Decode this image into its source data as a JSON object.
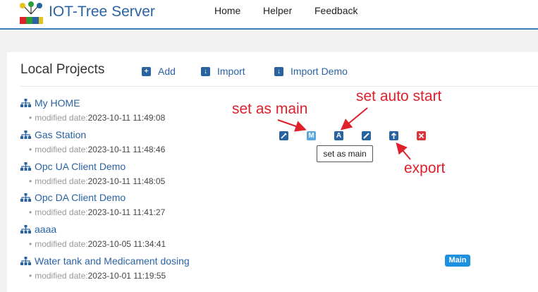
{
  "header": {
    "brand": "IOT-Tree Server",
    "nav": [
      "Home",
      "Helper",
      "Feedback"
    ]
  },
  "panel": {
    "title": "Local Projects",
    "toolbar": {
      "add": "Add",
      "import": "Import",
      "import_demo": "Import Demo"
    }
  },
  "projects": [
    {
      "name": "My HOME",
      "date_label": "modified date:",
      "date": "2023-10-11 11:49:08"
    },
    {
      "name": "Gas Station",
      "date_label": "modified date:",
      "date": "2023-10-11 11:48:46"
    },
    {
      "name": "Opc UA Client Demo",
      "date_label": "modified date:",
      "date": "2023-10-11 11:48:05"
    },
    {
      "name": "Opc DA Client Demo",
      "date_label": "modified date:",
      "date": "2023-10-11 11:41:27"
    },
    {
      "name": "aaaa",
      "date_label": "modified date:",
      "date": "2023-10-05 11:34:41"
    },
    {
      "name": "Water tank and Medicament dosing",
      "date_label": "modified date:",
      "date": "2023-10-01 11:19:55"
    }
  ],
  "row_actions": {
    "main_letter": "M",
    "auto_letter": "A",
    "tooltip": "set as main"
  },
  "badge": "Main",
  "annotations": {
    "set_as_main": "set as main",
    "set_auto_start": "set auto start",
    "export": "export"
  },
  "colors": {
    "brand_blue": "#2a63a2",
    "annotation_red": "#e0202a",
    "badge_blue": "#1e90e0",
    "delete_red": "#d9363e"
  }
}
